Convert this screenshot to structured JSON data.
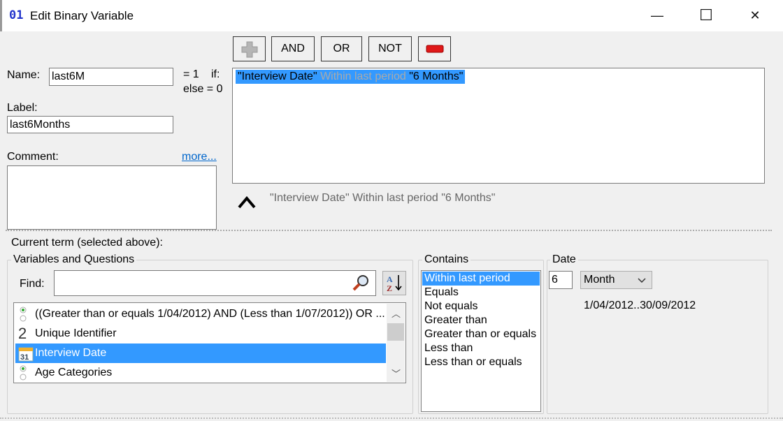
{
  "window": {
    "title": "Edit Binary Variable",
    "icon_text": "01",
    "controls": {
      "minimize": "—",
      "maximize": "☐",
      "close": "✕"
    }
  },
  "toolbar": {
    "add_icon": "plus-icon",
    "and_label": "AND",
    "or_label": "OR",
    "not_label": "NOT",
    "remove_icon": "minus-icon"
  },
  "form": {
    "name_label": "Name:",
    "name_value": "last6M",
    "eq1": "= 1",
    "if": "if:",
    "else": "else = 0",
    "label_label": "Label:",
    "label_value": "last6Months",
    "comment_label": "Comment:",
    "more_link": "more...",
    "comment_value": ""
  },
  "expression": {
    "var": "\"Interview Date\"",
    "op": "Within last period",
    "val": "\"6 Months\"",
    "preview": "\"Interview Date\" Within last period \"6 Months\"",
    "caret_icon": "caret-up-icon"
  },
  "current_term_label": "Current term (selected above):",
  "variables": {
    "group_label": "Variables and Questions",
    "find_label": "Find:",
    "find_value": "",
    "search_icon": "magnifier-icon",
    "sort_icon": "sort-az-icon",
    "items": [
      {
        "icon": "radio-categorical-icon",
        "label": "((Greater than or equals 1/04/2012) AND (Less than 1/07/2012)) OR ..."
      },
      {
        "icon": "numeric-2-icon",
        "label": "Unique Identifier"
      },
      {
        "icon": "calendar-icon",
        "label": "Interview Date",
        "selected": true
      },
      {
        "icon": "radio-categorical-icon",
        "label": "Age Categories"
      }
    ]
  },
  "contains": {
    "group_label": "Contains",
    "options": [
      "Within last period",
      "Equals",
      "Not equals",
      "Greater than",
      "Greater than or equals",
      "Less than",
      "Less than or equals"
    ],
    "selected": "Within last period"
  },
  "date": {
    "group_label": "Date",
    "count": "6",
    "unit": "Month",
    "range": "1/04/2012..30/09/2012"
  },
  "colors": {
    "selection": "#3399ff",
    "operator_text": "#999999"
  }
}
